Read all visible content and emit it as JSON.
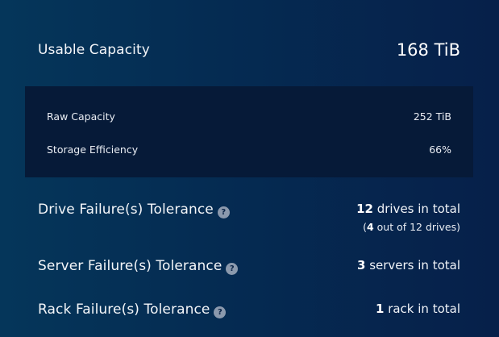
{
  "summary": {
    "usable_label": "Usable Capacity",
    "usable_value": "168 TiB"
  },
  "details": [
    {
      "label": "Raw Capacity",
      "value": "252 TiB"
    },
    {
      "label": "Storage Efficiency",
      "value": "66%"
    }
  ],
  "tolerances": {
    "drive": {
      "label": "Drive Failure(s) Tolerance",
      "count": "12",
      "unit_text": " drives in total",
      "sub_open": "(",
      "sub_count": "4",
      "sub_text": " out of 12 drives)"
    },
    "server": {
      "label": "Server Failure(s) Tolerance",
      "count": "3",
      "unit_text": " servers in total"
    },
    "rack": {
      "label": "Rack Failure(s) Tolerance",
      "count": "1",
      "unit_text": " rack in total"
    }
  },
  "help_icon_glyph": "?",
  "colors": {
    "background_start": "#05365a",
    "background_end": "#06204a",
    "details_panel": "#061a38",
    "help_icon": "#8b99ad"
  }
}
